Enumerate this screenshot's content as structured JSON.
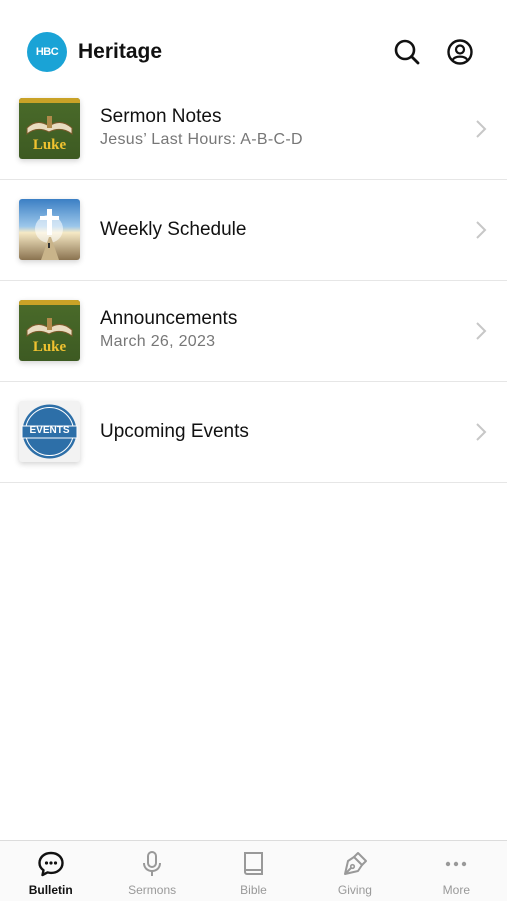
{
  "header": {
    "logo_text": "HBC",
    "title": "Heritage",
    "search_icon": "search-icon",
    "account_icon": "user-circle-icon"
  },
  "items": [
    {
      "title": "Sermon Notes",
      "subtitle": "Jesus’ Last Hours: A-B-C-D",
      "thumb_text": "Luke"
    },
    {
      "title": "Weekly Schedule",
      "subtitle": ""
    },
    {
      "title": "Announcements",
      "subtitle": "March 26, 2023",
      "thumb_text": "Luke"
    },
    {
      "title": "Upcoming Events",
      "subtitle": "",
      "thumb_text": "EVENTS"
    }
  ],
  "tabs": [
    {
      "label": "Bulletin",
      "icon": "chat-bubble-icon",
      "active": true
    },
    {
      "label": "Sermons",
      "icon": "microphone-icon",
      "active": false
    },
    {
      "label": "Bible",
      "icon": "book-icon",
      "active": false
    },
    {
      "label": "Giving",
      "icon": "pen-icon",
      "active": false
    },
    {
      "label": "More",
      "icon": "more-dots-icon",
      "active": false
    }
  ],
  "colors": {
    "brand": "#1aa3d6",
    "active_tab": "#111111",
    "inactive_tab": "#999999"
  }
}
